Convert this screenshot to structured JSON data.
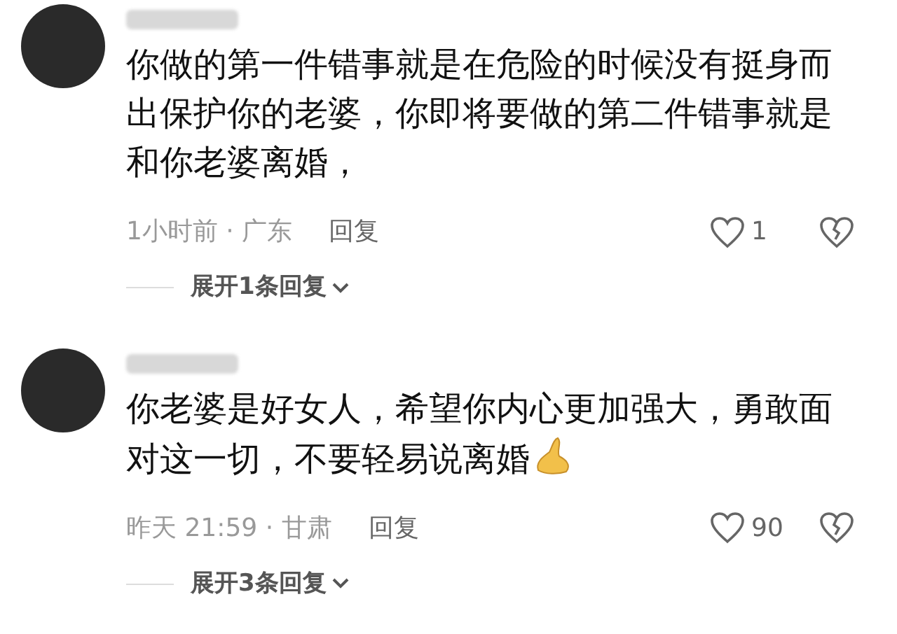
{
  "comments": [
    {
      "text": "你做的第一件错事就是在危险的时候没有挺身而出保护你的老婆，你即将要做的第二件错事就是和你老婆离婚，",
      "emoji": false,
      "time_location": "1小时前 · 广东",
      "reply": "回复",
      "likes": "1",
      "expand": "展开1条回复"
    },
    {
      "text": "你老婆是好女人，希望你内心更加强大，勇敢面对这一切，不要轻易说离婚",
      "emoji": true,
      "time_location": "昨天 21:59 · 甘肃",
      "reply": "回复",
      "likes": "90",
      "expand": "展开3条回复"
    }
  ]
}
